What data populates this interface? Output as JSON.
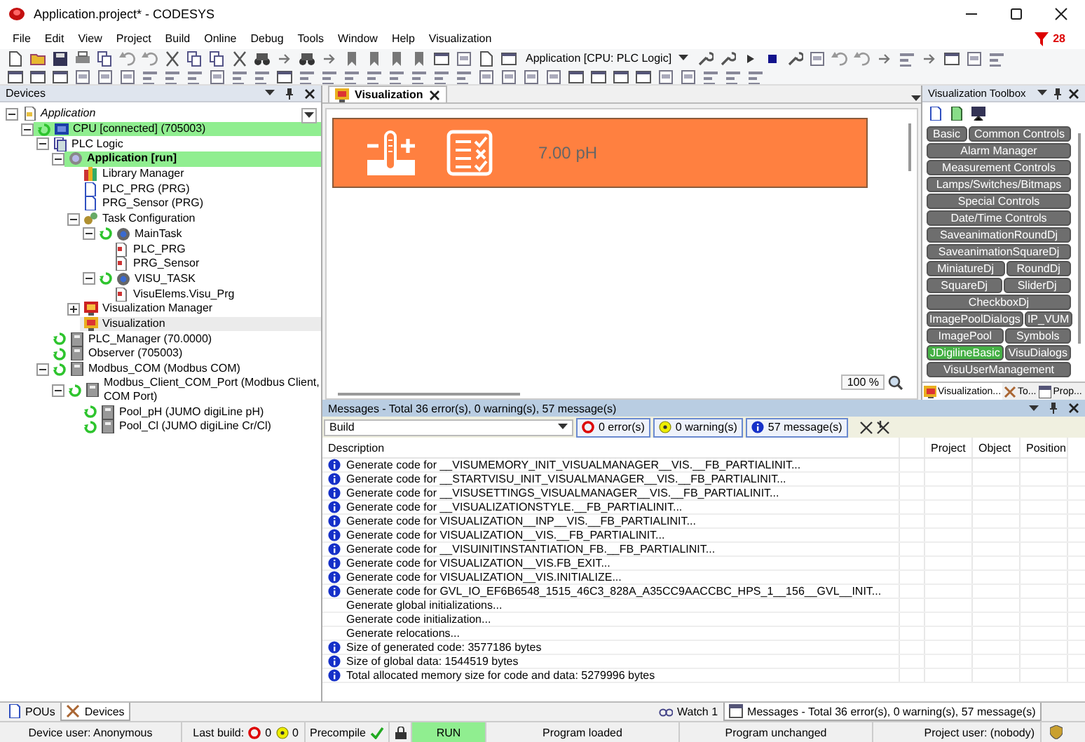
{
  "window": {
    "title": "Application.project* - CODESYS"
  },
  "menu": [
    "File",
    "Edit",
    "View",
    "Project",
    "Build",
    "Online",
    "Debug",
    "Tools",
    "Window",
    "Help",
    "Visualization"
  ],
  "notification_count": "28",
  "toolbar": {
    "active_application": "Application [CPU: PLC Logic]"
  },
  "devices": {
    "title": "Devices",
    "tree": [
      {
        "label": "Application",
        "kind": "project",
        "expanded": true,
        "selected": false,
        "highlighted": false,
        "active": false,
        "running": false,
        "children": [
          {
            "label": "CPU [connected] (705003)",
            "kind": "cpu",
            "expanded": true,
            "selected": false,
            "highlighted": true,
            "active": false,
            "running": true,
            "children": [
              {
                "label": "PLC Logic",
                "kind": "plc-logic",
                "expanded": true,
                "selected": false,
                "highlighted": false,
                "active": false,
                "running": false,
                "children": [
                  {
                    "label": "Application [run]",
                    "kind": "application",
                    "expanded": true,
                    "selected": false,
                    "highlighted": true,
                    "active": true,
                    "running": false,
                    "children": [
                      {
                        "label": "Library Manager",
                        "kind": "library",
                        "selected": false,
                        "highlighted": false,
                        "active": false,
                        "running": false
                      },
                      {
                        "label": "PLC_PRG (PRG)",
                        "kind": "pou",
                        "selected": false,
                        "highlighted": false,
                        "active": false,
                        "running": false
                      },
                      {
                        "label": "PRG_Sensor (PRG)",
                        "kind": "pou",
                        "selected": false,
                        "highlighted": false,
                        "active": false,
                        "running": false
                      },
                      {
                        "label": "Task Configuration",
                        "kind": "task-config",
                        "expanded": true,
                        "selected": false,
                        "highlighted": false,
                        "active": false,
                        "running": false,
                        "children": [
                          {
                            "label": "MainTask",
                            "kind": "task",
                            "expanded": true,
                            "selected": false,
                            "highlighted": false,
                            "active": false,
                            "running": true,
                            "children": [
                              {
                                "label": "PLC_PRG",
                                "kind": "task-pou",
                                "selected": false,
                                "highlighted": false,
                                "active": false,
                                "running": false
                              },
                              {
                                "label": "PRG_Sensor",
                                "kind": "task-pou",
                                "selected": false,
                                "highlighted": false,
                                "active": false,
                                "running": false
                              }
                            ]
                          },
                          {
                            "label": "VISU_TASK",
                            "kind": "task",
                            "expanded": true,
                            "selected": false,
                            "highlighted": false,
                            "active": false,
                            "running": true,
                            "children": [
                              {
                                "label": "VisuElems.Visu_Prg",
                                "kind": "task-pou",
                                "selected": false,
                                "highlighted": false,
                                "active": false,
                                "running": false
                              }
                            ]
                          }
                        ]
                      },
                      {
                        "label": "Visualization Manager",
                        "kind": "visu-manager",
                        "expanded": false,
                        "selected": false,
                        "highlighted": false,
                        "active": false,
                        "running": false
                      },
                      {
                        "label": "Visualization",
                        "kind": "visu",
                        "selected": true,
                        "highlighted": false,
                        "active": false,
                        "running": false
                      }
                    ]
                  }
                ]
              },
              {
                "label": "PLC_Manager (70.0000)",
                "kind": "device",
                "selected": false,
                "highlighted": false,
                "active": false,
                "running": true
              },
              {
                "label": "Observer (705003)",
                "kind": "device",
                "selected": false,
                "highlighted": false,
                "active": false,
                "running": true
              },
              {
                "label": "Modbus_COM (Modbus COM)",
                "kind": "device",
                "expanded": true,
                "selected": false,
                "highlighted": false,
                "active": false,
                "running": true,
                "children": [
                  {
                    "label": "Modbus_Client_COM_Port (Modbus Client, COM Port)",
                    "kind": "device",
                    "expanded": true,
                    "selected": false,
                    "highlighted": false,
                    "active": false,
                    "running": true,
                    "children": [
                      {
                        "label": "Pool_pH (JUMO digiLine pH)",
                        "kind": "device",
                        "selected": false,
                        "highlighted": false,
                        "active": false,
                        "running": true
                      },
                      {
                        "label": "Pool_Cl (JUMO digiLine Cr/Cl)",
                        "kind": "device",
                        "selected": false,
                        "highlighted": false,
                        "active": false,
                        "running": true
                      }
                    ]
                  }
                ]
              }
            ]
          }
        ]
      }
    ]
  },
  "editor": {
    "tab": "Visualization",
    "reading": "7.00 pH",
    "zoom": "100 %"
  },
  "toolbox": {
    "title": "Visualization Toolbox",
    "rows": [
      [
        {
          "label": "Basic",
          "selected": false
        },
        {
          "label": "Common Controls",
          "selected": false
        }
      ],
      [
        {
          "label": "Alarm Manager",
          "selected": false
        }
      ],
      [
        {
          "label": "Measurement Controls",
          "selected": false
        }
      ],
      [
        {
          "label": "Lamps/Switches/Bitmaps",
          "selected": false
        }
      ],
      [
        {
          "label": "Special Controls",
          "selected": false
        }
      ],
      [
        {
          "label": "Date/Time Controls",
          "selected": false
        }
      ],
      [
        {
          "label": "SaveanimationRoundDj",
          "selected": false
        }
      ],
      [
        {
          "label": "SaveanimationSquareDj",
          "selected": false
        }
      ],
      [
        {
          "label": "MiniatureDj",
          "selected": false
        },
        {
          "label": "RoundDj",
          "selected": false
        }
      ],
      [
        {
          "label": "SquareDj",
          "selected": false
        },
        {
          "label": "SliderDj",
          "selected": false
        }
      ],
      [
        {
          "label": "CheckboxDj",
          "selected": false
        }
      ],
      [
        {
          "label": "ImagePoolDialogs",
          "selected": false
        },
        {
          "label": "IP_VUM",
          "selected": false
        }
      ],
      [
        {
          "label": "ImagePool",
          "selected": false
        },
        {
          "label": "Symbols",
          "selected": false
        }
      ],
      [
        {
          "label": "JDigilineBasic",
          "selected": true
        },
        {
          "label": "VisuDialogs",
          "selected": false
        }
      ],
      [
        {
          "label": "VisuUserManagement",
          "selected": false
        }
      ]
    ],
    "tabs": [
      {
        "label": "Visualization...",
        "selected": true
      },
      {
        "label": "To...",
        "selected": false
      },
      {
        "label": "Prop...",
        "selected": false
      }
    ]
  },
  "messages": {
    "title": "Messages - Total 36 error(s), 0 warning(s), 57 message(s)",
    "source": "Build",
    "filters": [
      {
        "kind": "error",
        "label": "0 error(s)",
        "selected": true
      },
      {
        "kind": "warning",
        "label": "0 warning(s)",
        "selected": true
      },
      {
        "kind": "info",
        "label": "57 message(s)",
        "selected": true
      }
    ],
    "columns": [
      "Description",
      "Project",
      "Object",
      "Position"
    ],
    "rows": [
      {
        "kind": "info",
        "text": "Generate code for __VISUMEMORY_INIT_VISUALMANAGER__VIS.__FB_PARTIALINIT..."
      },
      {
        "kind": "info",
        "text": "Generate code for __STARTVISU_INIT_VISUALMANAGER__VIS.__FB_PARTIALINIT..."
      },
      {
        "kind": "info",
        "text": "Generate code for __VISUSETTINGS_VISUALMANAGER__VIS.__FB_PARTIALINIT..."
      },
      {
        "kind": "info",
        "text": "Generate code for __VISUALIZATIONSTYLE.__FB_PARTIALINIT..."
      },
      {
        "kind": "info",
        "text": "Generate code for VISUALIZATION__INP__VIS.__FB_PARTIALINIT..."
      },
      {
        "kind": "info",
        "text": "Generate code for VISUALIZATION__VIS.__FB_PARTIALINIT..."
      },
      {
        "kind": "info",
        "text": "Generate code for __VISUINITINSTANTIATION_FB.__FB_PARTIALINIT..."
      },
      {
        "kind": "info",
        "text": "Generate code for VISUALIZATION__VIS.FB_EXIT..."
      },
      {
        "kind": "info",
        "text": "Generate code for VISUALIZATION__VIS.INITIALIZE..."
      },
      {
        "kind": "info",
        "text": "Generate code for GVL_IO_EF6B6548_1515_46C3_828A_A35CC9AACCBC_HPS_1__156__GVL__INIT..."
      },
      {
        "kind": "plain",
        "text": "Generate global initializations..."
      },
      {
        "kind": "plain",
        "text": "Generate code initialization..."
      },
      {
        "kind": "plain",
        "text": "Generate relocations..."
      },
      {
        "kind": "info",
        "text": "Size of generated code: 3577186 bytes"
      },
      {
        "kind": "info",
        "text": "Size of global data: 1544519 bytes"
      },
      {
        "kind": "info",
        "text": "Total allocated memory size for code and data: 5279996 bytes"
      }
    ]
  },
  "bottom_tabs_left": [
    {
      "label": "POUs",
      "selected": false
    },
    {
      "label": "Devices",
      "selected": true
    }
  ],
  "bottom_tabs_center": [
    {
      "label": "Watch 1",
      "selected": false
    },
    {
      "label": "Messages - Total 36 error(s), 0 warning(s), 57 message(s)",
      "selected": true
    }
  ],
  "status_bar": {
    "device_user": "Device user: Anonymous",
    "last_build_label": "Last build:",
    "last_build_errors": "0",
    "last_build_warnings": "0",
    "precompile": "Precompile",
    "precompile_ok": true,
    "run_state": "RUN",
    "program_state": "Program loaded",
    "change_state": "Program unchanged",
    "project_user": "Project user: (nobody)"
  }
}
